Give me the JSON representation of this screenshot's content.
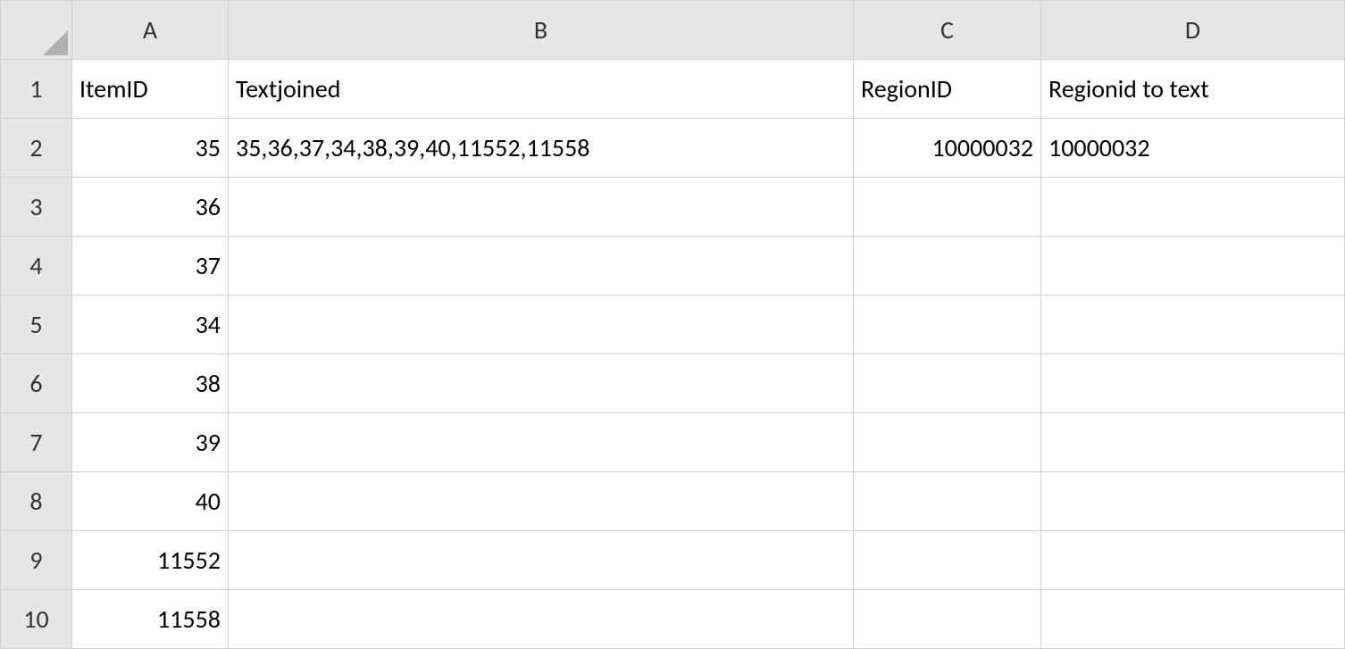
{
  "columns": {
    "A": "A",
    "B": "B",
    "C": "C",
    "D": "D"
  },
  "rowLabels": [
    "1",
    "2",
    "3",
    "4",
    "5",
    "6",
    "7",
    "8",
    "9",
    "10"
  ],
  "headers": {
    "A": "ItemID",
    "B": "Textjoined",
    "C": "RegionID",
    "D": "Regionid to text"
  },
  "data": {
    "row2": {
      "A": "35",
      "B": "35,36,37,34,38,39,40,11552,11558",
      "C": "10000032",
      "D": "10000032"
    },
    "row3": {
      "A": "36"
    },
    "row4": {
      "A": "37"
    },
    "row5": {
      "A": "34"
    },
    "row6": {
      "A": "38"
    },
    "row7": {
      "A": "39"
    },
    "row8": {
      "A": "40"
    },
    "row9": {
      "A": "11552"
    },
    "row10": {
      "A": "11558"
    }
  }
}
